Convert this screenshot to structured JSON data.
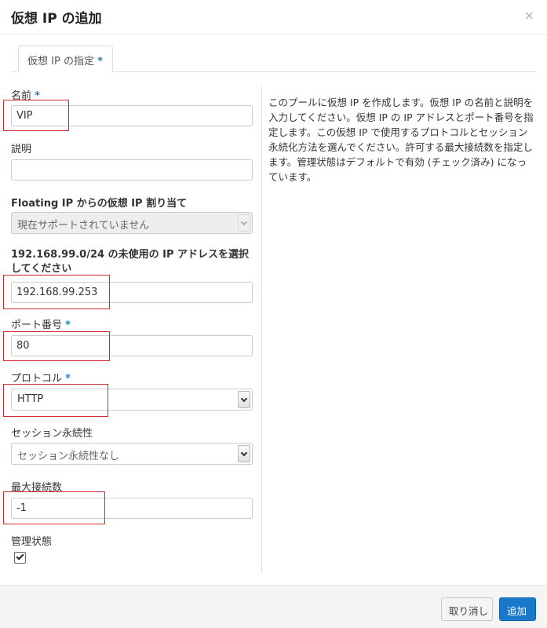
{
  "dialog": {
    "title": "仮想 IP の追加",
    "close_label": "×"
  },
  "tab": {
    "label": "仮想 IP の指定",
    "required_mark": "*"
  },
  "form": {
    "name": {
      "label": "名前",
      "required_mark": "*",
      "value": "VIP"
    },
    "description": {
      "label": "説明",
      "value": ""
    },
    "floating_ip": {
      "label": "Floating IP からの仮想 IP 割り当て",
      "value": "現在サポートされていません"
    },
    "ip_address": {
      "label": "192.168.99.0/24 の未使用の IP アドレスを選択してください",
      "value": "192.168.99.253"
    },
    "port": {
      "label": "ポート番号",
      "required_mark": "*",
      "value": "80"
    },
    "protocol": {
      "label": "プロトコル",
      "required_mark": "*",
      "value": "HTTP"
    },
    "session_persistence": {
      "label": "セッション永続性",
      "value": "セッション永続性なし"
    },
    "max_connections": {
      "label": "最大接続数",
      "value": "-1"
    },
    "admin_state": {
      "label": "管理状態",
      "checked": true
    }
  },
  "help_text": "このプールに仮想 IP を作成します。仮想 IP の名前と説明を入力してください。仮想 IP の IP アドレスとポート番号を指定します。この仮想 IP で使用するプロトコルとセッション永続化方法を選んでください。許可する最大接続数を指定します。管理状態はデフォルトで有効 (チェック済み) になっています。",
  "footer": {
    "cancel_label": "取り消し",
    "submit_label": "追加"
  },
  "colors": {
    "accent": "#1a78c9",
    "required": "#2b7bc0",
    "highlight_box": "#d0262e"
  }
}
